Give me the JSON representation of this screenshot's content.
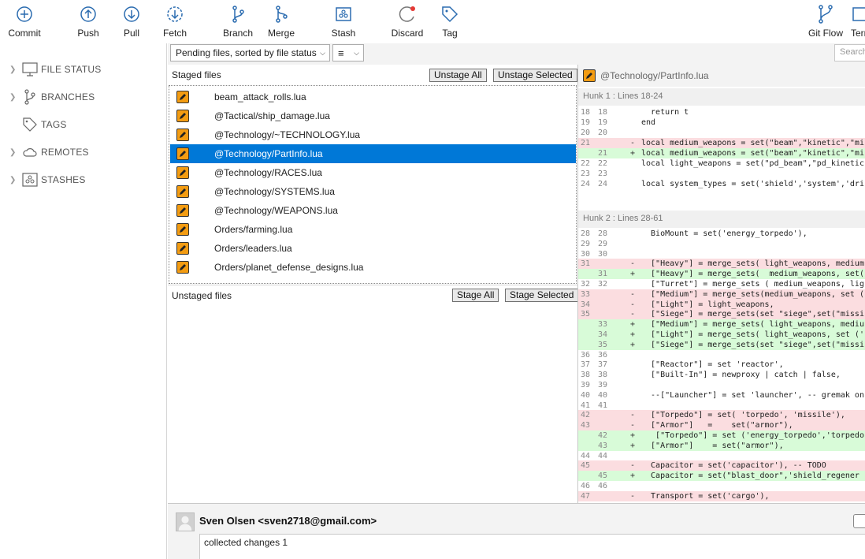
{
  "toolbar": {
    "commit": "Commit",
    "push": "Push",
    "pull": "Pull",
    "fetch": "Fetch",
    "branch": "Branch",
    "merge": "Merge",
    "stash": "Stash",
    "discard": "Discard",
    "tag": "Tag",
    "gitflow": "Git Flow",
    "terminal": "Terminal"
  },
  "sidebar": {
    "items": [
      {
        "label": "FILE STATUS",
        "icon": "monitor-icon"
      },
      {
        "label": "BRANCHES",
        "icon": "branch-icon"
      },
      {
        "label": "TAGS",
        "icon": "tag-icon"
      },
      {
        "label": "REMOTES",
        "icon": "cloud-icon"
      },
      {
        "label": "STASHES",
        "icon": "stash-icon"
      }
    ]
  },
  "filterbar": {
    "sort": "Pending files, sorted by file status",
    "search_placeholder": "Search"
  },
  "staged": {
    "title": "Staged files",
    "unstage_all": "Unstage All",
    "unstage_selected": "Unstage Selected",
    "files": [
      "beam_attack_rolls.lua",
      "@Tactical/ship_damage.lua",
      "@Technology/~TECHNOLOGY.lua",
      "@Technology/PartInfo.lua",
      "@Technology/RACES.lua",
      "@Technology/SYSTEMS.lua",
      "@Technology/WEAPONS.lua",
      "Orders/farming.lua",
      "Orders/leaders.lua",
      "Orders/planet_defense_designs.lua"
    ],
    "selected_index": 3
  },
  "unstaged": {
    "title": "Unstaged files",
    "stage_all": "Stage All",
    "stage_selected": "Stage Selected"
  },
  "diff": {
    "file": "@Technology/PartInfo.lua",
    "hunk1": "Hunk 1 : Lines 18-24",
    "hunk2": "Hunk 2 : Lines 28-61",
    "lines1": [
      {
        "o": "18",
        "n": "18",
        "m": "",
        "t": "  return t",
        "k": "ctx"
      },
      {
        "o": "19",
        "n": "19",
        "m": "",
        "t": "end",
        "k": "ctx"
      },
      {
        "o": "20",
        "n": "20",
        "m": "",
        "t": "",
        "k": "ctx"
      },
      {
        "o": "21",
        "n": "",
        "m": "-",
        "t": "local medium_weapons = set(\"beam\",\"kinetic\",\"mi",
        "k": "del"
      },
      {
        "o": "",
        "n": "21",
        "m": "+",
        "t": "local medium_weapons = set(\"beam\",\"kinetic\",\"mi",
        "k": "add"
      },
      {
        "o": "22",
        "n": "22",
        "m": "",
        "t": "local light_weapons = set(\"pd_beam\",\"pd_kinetic",
        "k": "ctx"
      },
      {
        "o": "23",
        "n": "23",
        "m": "",
        "t": "",
        "k": "ctx"
      },
      {
        "o": "24",
        "n": "24",
        "m": "",
        "t": "local system_types = set('shield','system','dri",
        "k": "ctx"
      }
    ],
    "lines2": [
      {
        "o": "28",
        "n": "28",
        "m": "",
        "t": "  BioMount = set('energy_torpedo'),",
        "k": "ctx"
      },
      {
        "o": "29",
        "n": "29",
        "m": "",
        "t": "",
        "k": "ctx"
      },
      {
        "o": "30",
        "n": "30",
        "m": "",
        "t": "",
        "k": "ctx"
      },
      {
        "o": "31",
        "n": "",
        "m": "-",
        "t": "  [\"Heavy\"] = merge_sets( light_weapons, medium",
        "k": "del"
      },
      {
        "o": "",
        "n": "31",
        "m": "+",
        "t": "  [\"Heavy\"] = merge_sets(  medium_weapons, set(",
        "k": "add"
      },
      {
        "o": "32",
        "n": "32",
        "m": "",
        "t": "  [\"Turret\"] = merge_sets ( medium_weapons, lig",
        "k": "ctx"
      },
      {
        "o": "33",
        "n": "",
        "m": "-",
        "t": "  [\"Medium\"] = merge_sets(medium_weapons, set (",
        "k": "del"
      },
      {
        "o": "34",
        "n": "",
        "m": "-",
        "t": "  [\"Light\"] = light_weapons,",
        "k": "del"
      },
      {
        "o": "35",
        "n": "",
        "m": "-",
        "t": "  [\"Siege\"] = merge_sets(set \"siege\",set(\"missi",
        "k": "del"
      },
      {
        "o": "",
        "n": "33",
        "m": "+",
        "t": "  [\"Medium\"] = merge_sets( light_weapons, mediu",
        "k": "add"
      },
      {
        "o": "",
        "n": "34",
        "m": "+",
        "t": "  [\"Light\"] = merge_sets( light_weapons, set ('",
        "k": "add"
      },
      {
        "o": "",
        "n": "35",
        "m": "+",
        "t": "  [\"Siege\"] = merge_sets(set \"siege\",set(\"missi",
        "k": "add"
      },
      {
        "o": "36",
        "n": "36",
        "m": "",
        "t": "",
        "k": "ctx"
      },
      {
        "o": "37",
        "n": "37",
        "m": "",
        "t": "  [\"Reactor\"] = set 'reactor',",
        "k": "ctx"
      },
      {
        "o": "38",
        "n": "38",
        "m": "",
        "t": "  [\"Built-In\"] = newproxy | catch | false,",
        "k": "ctx"
      },
      {
        "o": "39",
        "n": "39",
        "m": "",
        "t": "",
        "k": "ctx"
      },
      {
        "o": "40",
        "n": "40",
        "m": "",
        "t": "  --[\"Launcher\"] = set 'launcher', -- gremak on",
        "k": "ctx"
      },
      {
        "o": "41",
        "n": "41",
        "m": "",
        "t": "",
        "k": "ctx"
      },
      {
        "o": "42",
        "n": "",
        "m": "-",
        "t": "  [\"Torpedo\"] = set( 'torpedo', 'missile'),",
        "k": "del"
      },
      {
        "o": "43",
        "n": "",
        "m": "-",
        "t": "  [\"Armor\"]   =    set(\"armor\"),",
        "k": "del"
      },
      {
        "o": "",
        "n": "42",
        "m": "+",
        "t": "   [\"Torpedo\"] = set ('energy_torpedo','torpedo",
        "k": "add"
      },
      {
        "o": "",
        "n": "43",
        "m": "+",
        "t": "  [\"Armor\"]    = set(\"armor\"),",
        "k": "add"
      },
      {
        "o": "44",
        "n": "44",
        "m": "",
        "t": "",
        "k": "ctx"
      },
      {
        "o": "45",
        "n": "",
        "m": "-",
        "t": "  Capacitor = set('capacitor'), -- TODO",
        "k": "del"
      },
      {
        "o": "",
        "n": "45",
        "m": "+",
        "t": "  Capacitor = set(\"blast_door\",'shield_regener",
        "k": "add"
      },
      {
        "o": "46",
        "n": "46",
        "m": "",
        "t": "",
        "k": "ctx"
      },
      {
        "o": "47",
        "n": "",
        "m": "-",
        "t": "  Transport = set('cargo'),",
        "k": "del"
      }
    ]
  },
  "commit": {
    "author": "Sven Olsen <sven2718@gmail.com>",
    "message": "collected changes 1"
  },
  "colors": {
    "selection": "#0078d7",
    "file_icon": "#f39c12",
    "toolbar_icon": "#2b6cb0",
    "deleted_bg": "#fbdde0",
    "added_bg": "#d8fbd8"
  }
}
